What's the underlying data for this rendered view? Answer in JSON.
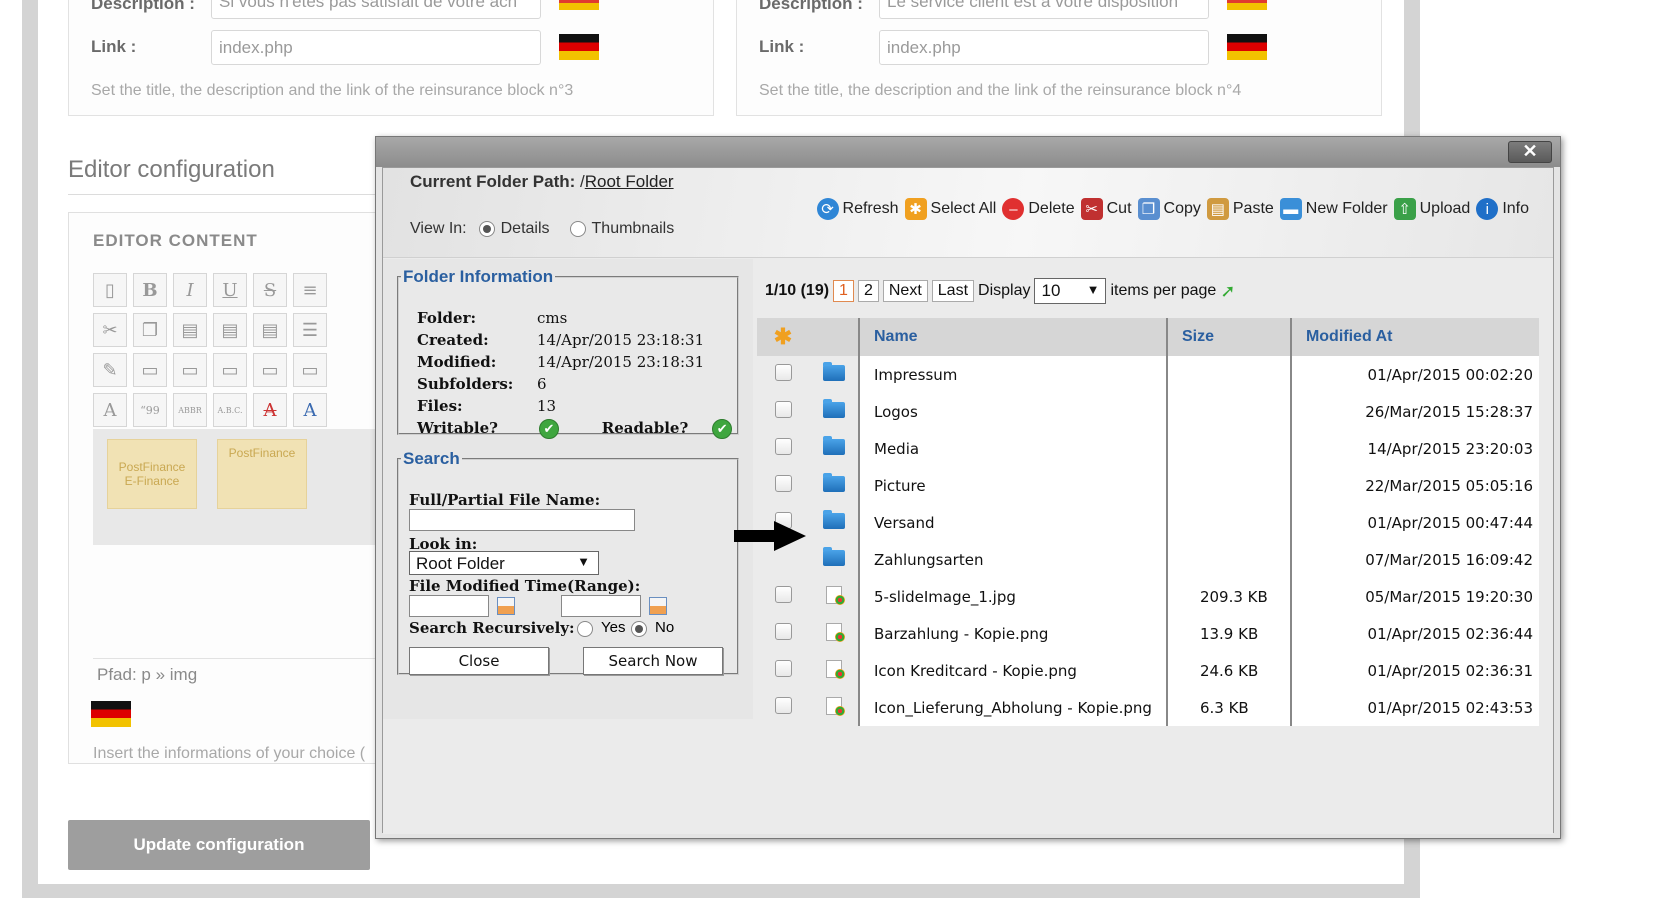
{
  "admin": {
    "block3": {
      "description_label": "Description :",
      "description_value": "Si vous n'êtes pas satisfait de votre ach",
      "link_label": "Link :",
      "link_value": "index.php",
      "help": "Set the title, the description and the link of the reinsurance block n°3"
    },
    "block4": {
      "description_label": "Description :",
      "description_value": "Le service client est à votre disposition",
      "link_label": "Link :",
      "link_value": "index.php",
      "help": "Set the title, the description and the link of the reinsurance block n°4"
    },
    "editor_title": "Editor configuration",
    "editor_content_label": "EDITOR CONTENT",
    "postfinance_card_1": "PostFinance E-Finance",
    "postfinance_card_2": "PostFinance",
    "editor_path": "Pfad: p » img",
    "insert_help": "Insert the informations of your choice (",
    "update_button": "Update configuration"
  },
  "dialog": {
    "close_label": "✕",
    "folder_path_label": "Current Folder Path:",
    "folder_path_prefix": " /",
    "folder_path_value": "Root Folder",
    "view_in_label": "View In:",
    "view_details": "Details",
    "view_thumbnails": "Thumbnails",
    "toolbar": [
      {
        "label": "Refresh",
        "icon": "refresh-icon",
        "color": "#2f86d6"
      },
      {
        "label": "Select All",
        "icon": "select-all-icon",
        "color": "#f0a020"
      },
      {
        "label": "Delete",
        "icon": "delete-icon",
        "color": "#e03030"
      },
      {
        "label": "Cut",
        "icon": "cut-icon",
        "color": "#c03030"
      },
      {
        "label": "Copy",
        "icon": "copy-icon",
        "color": "#5a8fd0"
      },
      {
        "label": "Paste",
        "icon": "paste-icon",
        "color": "#d09a40"
      },
      {
        "label": "New Folder",
        "icon": "new-folder-icon",
        "color": "#3a8fd8"
      },
      {
        "label": "Upload",
        "icon": "upload-icon",
        "color": "#3aa048"
      },
      {
        "label": "Info",
        "icon": "info-icon",
        "color": "#1f6fc8"
      }
    ],
    "folder_info": {
      "legend": "Folder Information",
      "folder_label": "Folder:",
      "folder_value": "cms",
      "created_label": "Created:",
      "created_value": "14/Apr/2015 23:18:31",
      "modified_label": "Modified:",
      "modified_value": "14/Apr/2015 23:18:31",
      "subfolders_label": "Subfolders:",
      "subfolders_value": "6",
      "files_label": "Files:",
      "files_value": "13",
      "writable_label": "Writable?",
      "readable_label": "Readable?"
    },
    "search": {
      "legend": "Search",
      "name_label": "Full/Partial File Name:",
      "look_in_label": "Look in:",
      "look_in_value": "Root Folder",
      "modified_label": "File Modified Time(Range):",
      "recursive_label": "Search Recursively:",
      "yes": "Yes",
      "no": "No",
      "close_button": "Close",
      "search_button": "Search Now"
    },
    "pager": {
      "status": "1/10 (19)",
      "page1": "1",
      "page2": "2",
      "next": "Next",
      "last": "Last",
      "display": "Display",
      "per_page_value": "10",
      "items_per_page": "items per page"
    },
    "table": {
      "columns": [
        "Name",
        "Size",
        "Modified At"
      ],
      "rows": [
        {
          "name": "Impressum",
          "size": "",
          "modified": "01/Apr/2015 00:02:20",
          "type": "folder"
        },
        {
          "name": "Logos",
          "size": "",
          "modified": "26/Mar/2015 15:28:37",
          "type": "folder"
        },
        {
          "name": "Media",
          "size": "",
          "modified": "14/Apr/2015 23:20:03",
          "type": "folder"
        },
        {
          "name": "Picture",
          "size": "",
          "modified": "22/Mar/2015 05:05:16",
          "type": "folder"
        },
        {
          "name": "Versand",
          "size": "",
          "modified": "01/Apr/2015 00:47:44",
          "type": "folder"
        },
        {
          "name": "Zahlungsarten",
          "size": "",
          "modified": "07/Mar/2015 16:09:42",
          "type": "folder"
        },
        {
          "name": "5-slideImage_1.jpg",
          "size": "209.3 KB",
          "modified": "05/Mar/2015 19:20:30",
          "type": "image"
        },
        {
          "name": "Barzahlung - Kopie.png",
          "size": "13.9 KB",
          "modified": "01/Apr/2015 02:36:44",
          "type": "image"
        },
        {
          "name": "Icon Kreditcard - Kopie.png",
          "size": "24.6 KB",
          "modified": "01/Apr/2015 02:36:31",
          "type": "image"
        },
        {
          "name": "Icon_Lieferung_Abholung - Kopie.png",
          "size": "6.3 KB",
          "modified": "01/Apr/2015 02:43:53",
          "type": "image"
        }
      ]
    }
  }
}
